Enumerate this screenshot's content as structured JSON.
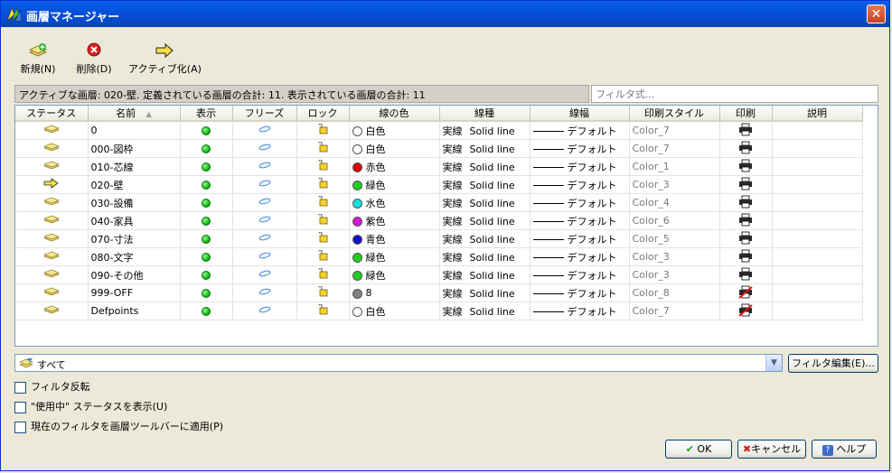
{
  "window": {
    "title": "画層マネージャー",
    "close_glyph": "✕"
  },
  "toolbar": {
    "new_label": "新規(N)",
    "delete_label": "削除(D)",
    "activate_label": "アクティブ化(A)"
  },
  "status_text": "アクティブな画層: 020-壁. 定義されている画層の合計: 11. 表示されている画層の合計: 11",
  "filter_search": {
    "placeholder": "フィルタ式..."
  },
  "columns": [
    "ステータス",
    "名前",
    "表示",
    "フリーズ",
    "ロック",
    "線の色",
    "線種",
    "線幅",
    "印刷スタイル",
    "印刷",
    "説明"
  ],
  "layers": [
    {
      "name": "0",
      "color_name": "白色",
      "color": "#FFFFFF",
      "linetype": "実線",
      "linetype_name": "Solid line",
      "lineweight": "デフォルト",
      "plotstyle": "Color_7",
      "active": false,
      "plot": true
    },
    {
      "name": "000-図枠",
      "color_name": "白色",
      "color": "#FFFFFF",
      "linetype": "実線",
      "linetype_name": "Solid line",
      "lineweight": "デフォルト",
      "plotstyle": "Color_7",
      "active": false,
      "plot": true
    },
    {
      "name": "010-芯線",
      "color_name": "赤色",
      "color": "#E00000",
      "linetype": "実線",
      "linetype_name": "Solid line",
      "lineweight": "デフォルト",
      "plotstyle": "Color_1",
      "active": false,
      "plot": true
    },
    {
      "name": "020-壁",
      "color_name": "緑色",
      "color": "#1ED01E",
      "linetype": "実線",
      "linetype_name": "Solid line",
      "lineweight": "デフォルト",
      "plotstyle": "Color_3",
      "active": true,
      "plot": true
    },
    {
      "name": "030-設備",
      "color_name": "水色",
      "color": "#10E0E0",
      "linetype": "実線",
      "linetype_name": "Solid line",
      "lineweight": "デフォルト",
      "plotstyle": "Color_4",
      "active": false,
      "plot": true
    },
    {
      "name": "040-家具",
      "color_name": "紫色",
      "color": "#E010E0",
      "linetype": "実線",
      "linetype_name": "Solid line",
      "lineweight": "デフォルト",
      "plotstyle": "Color_6",
      "active": false,
      "plot": true
    },
    {
      "name": "070-寸法",
      "color_name": "青色",
      "color": "#1010D0",
      "linetype": "実線",
      "linetype_name": "Solid line",
      "lineweight": "デフォルト",
      "plotstyle": "Color_5",
      "active": false,
      "plot": true
    },
    {
      "name": "080-文字",
      "color_name": "緑色",
      "color": "#1ED01E",
      "linetype": "実線",
      "linetype_name": "Solid line",
      "lineweight": "デフォルト",
      "plotstyle": "Color_3",
      "active": false,
      "plot": true
    },
    {
      "name": "090-その他",
      "color_name": "緑色",
      "color": "#1ED01E",
      "linetype": "実線",
      "linetype_name": "Solid line",
      "lineweight": "デフォルト",
      "plotstyle": "Color_3",
      "active": false,
      "plot": true
    },
    {
      "name": "999-OFF",
      "color_name": "8",
      "color": "#808080",
      "linetype": "実線",
      "linetype_name": "Solid line",
      "lineweight": "デフォルト",
      "plotstyle": "Color_8",
      "active": false,
      "plot": false
    },
    {
      "name": "Defpoints",
      "color_name": "白色",
      "color": "#FFFFFF",
      "linetype": "実線",
      "linetype_name": "Solid line",
      "lineweight": "デフォルト",
      "plotstyle": "Color_7",
      "active": false,
      "plot": false
    }
  ],
  "filter_combo": {
    "value": "すべて"
  },
  "buttons": {
    "edit_filter": "フィルタ編集(E)...",
    "ok": "OK",
    "cancel": "キャンセル",
    "help": "ヘルプ"
  },
  "checkboxes": {
    "invert_filter": "フィルタ反転",
    "show_in_use": "\"使用中\" ステータスを表示(U)",
    "apply_to_toolbar": "現在のフィルタを画層ツールバーに適用(P)"
  },
  "colors": {
    "accent": "#0A47C8",
    "background": "#ECE9D8"
  }
}
